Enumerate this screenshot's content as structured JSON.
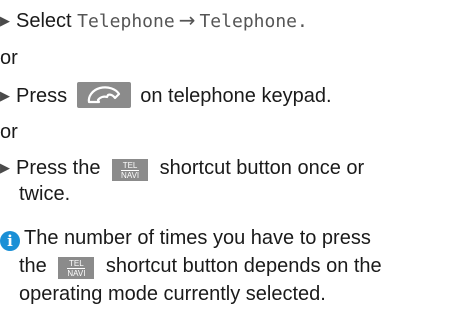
{
  "steps": [
    {
      "prefix": "Select",
      "menu_item_1": "Telephone",
      "arrow": "→",
      "menu_item_2": "Telephone."
    },
    {
      "or_label": "or"
    },
    {
      "prefix": "Press",
      "suffix": "on telephone keypad."
    },
    {
      "or_label": "or"
    },
    {
      "prefix": "Press the",
      "suffix_line1": "shortcut button once or",
      "line2": "twice."
    }
  ],
  "tel_navi_button": {
    "top_label": "TEL",
    "bottom_label": "NAVI"
  },
  "note": {
    "icon": "info-icon",
    "line1": "The number of times you have to press",
    "line2_prefix": "the",
    "line2_suffix": "shortcut button depends on the",
    "line3": "operating mode currently selected."
  },
  "colors": {
    "info_icon": "#1a8fd6",
    "button_gray": "#8b8b8b"
  }
}
